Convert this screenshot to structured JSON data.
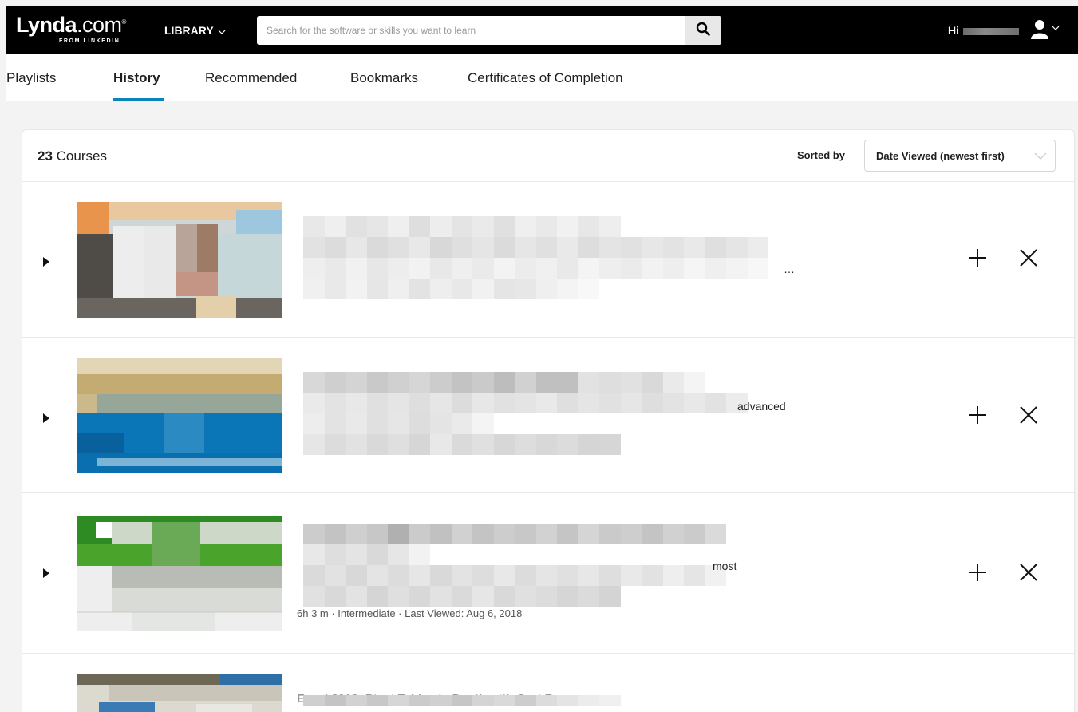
{
  "header": {
    "logo_brand": "Lynda",
    "logo_dotcom": ".com",
    "logo_reg": "®",
    "logo_sub": "FROM LINKEDIN",
    "library_label": "LIBRARY",
    "search_placeholder": "Search for the software or skills you want to learn",
    "greeting": "Hi",
    "icons": {
      "search": "search-icon",
      "user": "user-icon",
      "chevron": "chevron-down-icon"
    }
  },
  "tabs": [
    {
      "label": "Playlists",
      "active": false
    },
    {
      "label": "History",
      "active": true
    },
    {
      "label": "Recommended",
      "active": false
    },
    {
      "label": "Bookmarks",
      "active": false
    },
    {
      "label": "Certificates of Completion",
      "active": false
    }
  ],
  "list": {
    "count_number": "23",
    "count_label": " Courses",
    "sorted_by_label": "Sorted by",
    "sort_value": "Date Viewed (newest first)"
  },
  "courses": [
    {
      "visible_fragment": "…"
    },
    {
      "visible_fragment": "advanced"
    },
    {
      "visible_fragment": "most",
      "meta_visible": "6h 3 m · Intermediate · Last Viewed: Aug 6, 2018"
    },
    {
      "title_visible": "Excel 2013: Pivot Tables in Depth with Curt Frye"
    }
  ],
  "row_actions": {
    "add": "plus-icon",
    "remove": "close-icon"
  },
  "colors": {
    "topbar": "#000000",
    "accent": "#0a84ba",
    "page_bg": "#f3f3f3"
  }
}
